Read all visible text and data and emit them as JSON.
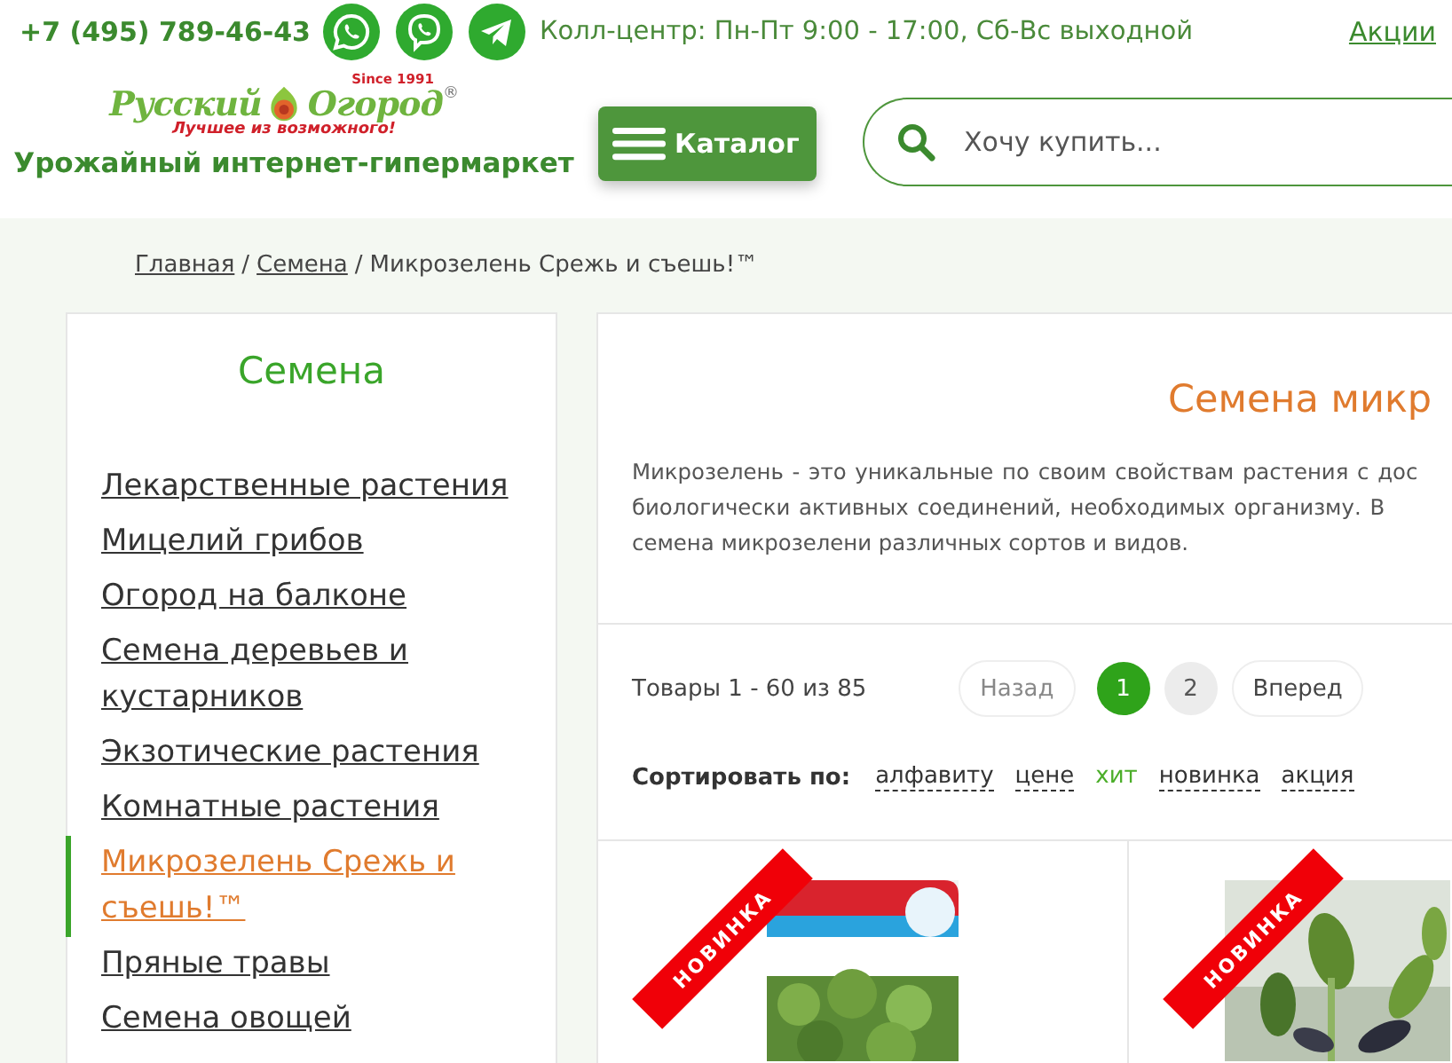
{
  "topbar": {
    "phone": "+7 (495) 789-46-43",
    "messengers": [
      {
        "kind": "whatsapp"
      },
      {
        "kind": "viber"
      },
      {
        "kind": "telegram"
      }
    ],
    "hours": "Колл-центр: Пн-Пт 9:00 - 17:00, Сб-Вс выходной",
    "promo_link": "Акции"
  },
  "header": {
    "logo": {
      "word_1": "Русский",
      "word_2": "Огород",
      "since": "Since 1991",
      "slogan": "Лучшее из возможного!",
      "trademark": "®"
    },
    "tagline": "Урожайный интернет-гипермаркет",
    "catalog_button": "Каталог",
    "search": {
      "placeholder": "Хочу купить..."
    }
  },
  "breadcrumbs": {
    "separator": "/",
    "items": [
      {
        "label": "Главная",
        "link": true
      },
      {
        "label": "Семена",
        "link": true
      },
      {
        "label": "Микрозелень Срежь и съешь!™",
        "link": false
      }
    ]
  },
  "sidebar": {
    "title": "Семена",
    "items": [
      {
        "label": "Лекарственные растения",
        "selected": false
      },
      {
        "label": "Мицелий грибов",
        "selected": false
      },
      {
        "label": "Огород на балконе",
        "selected": false
      },
      {
        "label": "Семена деревьев и кустарников",
        "selected": false
      },
      {
        "label": "Экзотические растения",
        "selected": false
      },
      {
        "label": "Комнатные растения",
        "selected": false
      },
      {
        "label": "Микрозелень Срежь и съешь!™",
        "selected": true
      },
      {
        "label": "Пряные травы",
        "selected": false
      },
      {
        "label": "Семена овощей",
        "selected": false
      }
    ]
  },
  "main": {
    "title": "Семена микр",
    "description": [
      "Микрозелень - это уникальные по своим свойствам растения с дос",
      "биологически активных соединений, необходимых организму. В",
      "семена микрозелени различных сортов и видов."
    ],
    "pagination": {
      "summary": "Товары 1 - 60 из 85",
      "prev": "Назад",
      "pages": [
        {
          "label": "1",
          "selected": true
        },
        {
          "label": "2",
          "selected": false
        }
      ],
      "next": "Вперед"
    },
    "sort": {
      "label": "Сортировать по:",
      "options": [
        {
          "label": "алфавиту",
          "selected": false
        },
        {
          "label": "цене",
          "selected": false
        },
        {
          "label": "хит",
          "selected": true
        },
        {
          "label": "новинка",
          "selected": false
        },
        {
          "label": "акция",
          "selected": false
        }
      ]
    },
    "products": [
      {
        "badge": "НОВИНКА"
      },
      {
        "badge": "НОВИНКА"
      }
    ]
  }
}
